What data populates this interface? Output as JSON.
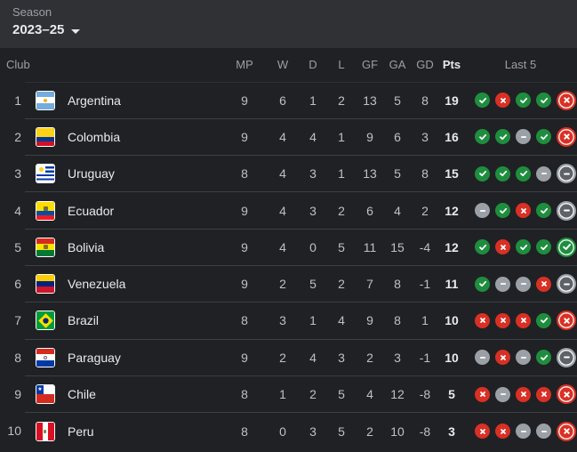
{
  "season": {
    "label": "Season",
    "value": "2023–25"
  },
  "columns": {
    "club": "Club",
    "mp": "MP",
    "w": "W",
    "d": "D",
    "l": "L",
    "gf": "GF",
    "ga": "GA",
    "gd": "GD",
    "pts": "Pts",
    "last5": "Last 5"
  },
  "colors": {
    "win": "#1e8e3e",
    "loss": "#d93025",
    "draw": "#9aa0a6"
  },
  "rows": [
    {
      "pos": "1",
      "club": "Argentina",
      "flag": "argentina-flag",
      "mp": "9",
      "w": "6",
      "d": "1",
      "l": "2",
      "gf": "13",
      "ga": "5",
      "gd": "8",
      "pts": "19",
      "last5": [
        "W",
        "L",
        "W",
        "W",
        "L"
      ]
    },
    {
      "pos": "2",
      "club": "Colombia",
      "flag": "colombia-flag",
      "mp": "9",
      "w": "4",
      "d": "4",
      "l": "1",
      "gf": "9",
      "ga": "6",
      "gd": "3",
      "pts": "16",
      "last5": [
        "W",
        "W",
        "D",
        "W",
        "L"
      ]
    },
    {
      "pos": "3",
      "club": "Uruguay",
      "flag": "uruguay-flag",
      "mp": "8",
      "w": "4",
      "d": "3",
      "l": "1",
      "gf": "13",
      "ga": "5",
      "gd": "8",
      "pts": "15",
      "last5": [
        "W",
        "W",
        "W",
        "D",
        "D"
      ]
    },
    {
      "pos": "4",
      "club": "Ecuador",
      "flag": "ecuador-flag",
      "mp": "9",
      "w": "4",
      "d": "3",
      "l": "2",
      "gf": "6",
      "ga": "4",
      "gd": "2",
      "pts": "12",
      "last5": [
        "D",
        "W",
        "L",
        "W",
        "D"
      ]
    },
    {
      "pos": "5",
      "club": "Bolivia",
      "flag": "bolivia-flag",
      "mp": "9",
      "w": "4",
      "d": "0",
      "l": "5",
      "gf": "11",
      "ga": "15",
      "gd": "-4",
      "pts": "12",
      "last5": [
        "W",
        "L",
        "W",
        "W",
        "W"
      ]
    },
    {
      "pos": "6",
      "club": "Venezuela",
      "flag": "venezuela-flag",
      "mp": "9",
      "w": "2",
      "d": "5",
      "l": "2",
      "gf": "7",
      "ga": "8",
      "gd": "-1",
      "pts": "11",
      "last5": [
        "W",
        "D",
        "D",
        "L",
        "D"
      ]
    },
    {
      "pos": "7",
      "club": "Brazil",
      "flag": "brazil-flag",
      "mp": "8",
      "w": "3",
      "d": "1",
      "l": "4",
      "gf": "9",
      "ga": "8",
      "gd": "1",
      "pts": "10",
      "last5": [
        "L",
        "L",
        "L",
        "W",
        "L"
      ]
    },
    {
      "pos": "8",
      "club": "Paraguay",
      "flag": "paraguay-flag",
      "mp": "9",
      "w": "2",
      "d": "4",
      "l": "3",
      "gf": "2",
      "ga": "3",
      "gd": "-1",
      "pts": "10",
      "last5": [
        "D",
        "L",
        "D",
        "W",
        "D"
      ]
    },
    {
      "pos": "9",
      "club": "Chile",
      "flag": "chile-flag",
      "mp": "8",
      "w": "1",
      "d": "2",
      "l": "5",
      "gf": "4",
      "ga": "12",
      "gd": "-8",
      "pts": "5",
      "last5": [
        "L",
        "D",
        "L",
        "L",
        "L"
      ]
    },
    {
      "pos": "10",
      "club": "Peru",
      "flag": "peru-flag",
      "mp": "8",
      "w": "0",
      "d": "3",
      "l": "5",
      "gf": "2",
      "ga": "10",
      "gd": "-8",
      "pts": "3",
      "last5": [
        "L",
        "L",
        "D",
        "D",
        "L"
      ]
    }
  ]
}
